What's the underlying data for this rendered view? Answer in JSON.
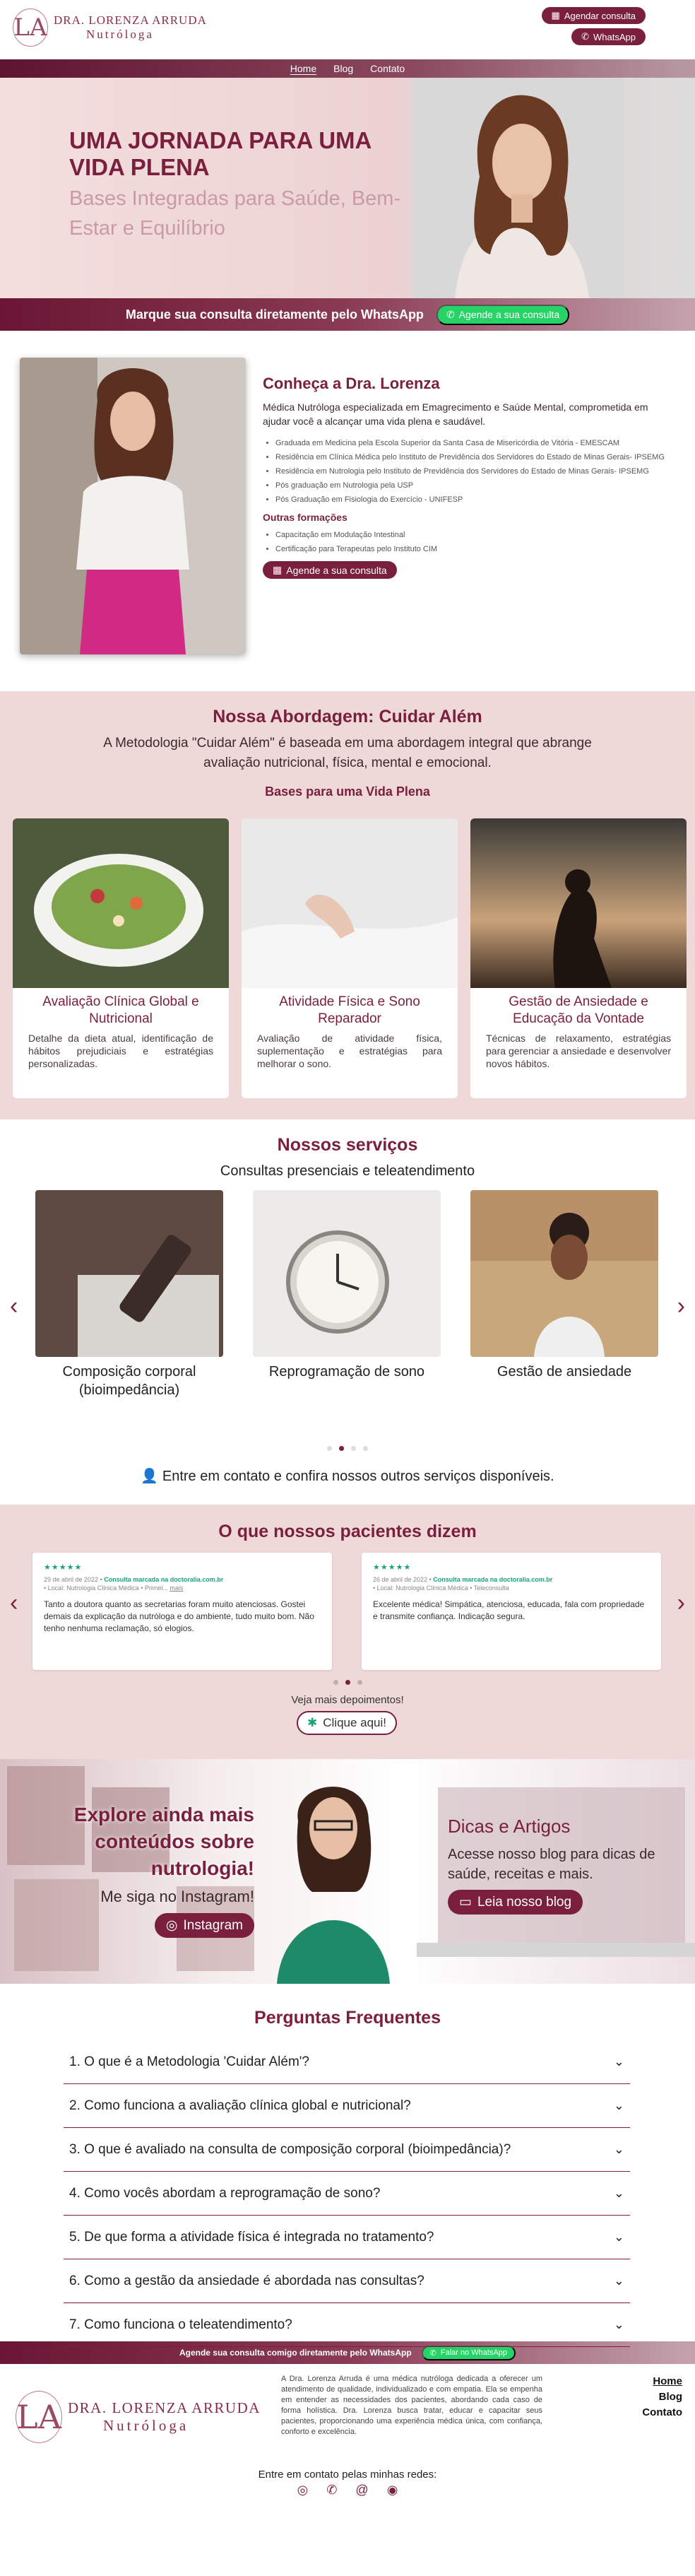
{
  "header": {
    "logo_line1": "DRA. LORENZA ARRUDA",
    "logo_line2": "Nutróloga",
    "logo_mark": "LA",
    "btn_schedule": "Agendar consulta",
    "btn_whatsapp": "WhatsApp"
  },
  "nav": {
    "items": [
      "Home",
      "Blog",
      "Contato"
    ],
    "active": "Home"
  },
  "hero": {
    "title": "UMA JORNADA PARA UMA VIDA PLENA",
    "subtitle": "Bases Integradas para Saúde, Bem-Estar e Equilíbrio"
  },
  "cta_bar": {
    "text": "Marque sua consulta diretamente pelo WhatsApp",
    "button": "Agende a sua consulta"
  },
  "about": {
    "title": "Conheça a Dra. Lorenza",
    "intro": "Médica Nutróloga especializada em Emagrecimento e Saúde Mental, comprometida em ajudar você a alcançar uma vida plena e saudável.",
    "education": [
      "Graduada em Medicina pela Escola Superior da Santa Casa de Misericórdia de Vitória - EMESCAM",
      "Residência em Clínica Médica pelo Instituto de Previdência dos Servidores do Estado de Minas Gerais- IPSEMG",
      "Residência em Nutrologia pelo Instituto de Previdência dos Servidores do Estado de Minas Gerais- IPSEMG",
      "Pós graduação em Nutrologia pela USP",
      "Pós Graduação em Fisiologia do Exercício - UNIFESP"
    ],
    "other_title": "Outras formações",
    "other": [
      "Capacitação em Modulação Intestinal",
      "Certificação para Terapeutas pelo Instituto CIM"
    ],
    "button": "Agende a sua consulta"
  },
  "approach": {
    "title": "Nossa Abordagem: Cuidar Além",
    "lead": "A Metodologia \"Cuidar Além\" é baseada em uma abordagem integral que abrange avaliação nutricional, física, mental e emocional.",
    "subtitle": "Bases para uma Vida Plena",
    "cards": [
      {
        "title": "Avaliação Clínica Global e Nutricional",
        "text": "Detalhe da dieta atual, identificação de hábitos prejudiciais e estratégias personalizadas."
      },
      {
        "title": "Atividade Física e Sono Reparador",
        "text": "Avaliação de atividade física, suplementação e estratégias para melhorar o sono."
      },
      {
        "title": "Gestão de Ansiedade e Educação da Vontade",
        "text": "Técnicas de relaxamento, estratégias para gerenciar a ansiedade e desenvolver novos hábitos."
      }
    ]
  },
  "services": {
    "title": "Nossos serviços",
    "subtitle": "Consultas presenciais e teleatendimento",
    "items": [
      {
        "caption": "Composição corporal (bioimpedância)"
      },
      {
        "caption": "Reprogramação de sono"
      },
      {
        "caption": "Gestão de ansiedade"
      }
    ],
    "dots": 4,
    "active_dot": 1,
    "contact": "Entre em contato e confira nossos outros serviços disponíveis."
  },
  "testimonials": {
    "title": "O que nossos pacientes dizem",
    "reviews": [
      {
        "stars": "★★★★★",
        "date": "29 de abril de 2022 •",
        "source": "Consulta marcada na doctoralia.com.br",
        "location": "• Local: Nutrologia Clínica Médica • Primei...",
        "more": "mais",
        "text": "Tanto a doutora quanto as secretarias foram muito atenciosas. Gostei demais da explicação da nutróloga e do ambiente, tudo muito bom. Não tenho nenhuma reclamação, só elogios."
      },
      {
        "stars": "★★★★★",
        "date": "26 de abril de 2022 •",
        "source": "Consulta marcada na doctoralia.com.br",
        "location": "• Local: Nutrologia Clínica Médica • Teleconsulta",
        "more": "",
        "text": "Excelente médica! Simpática, atenciosa, educada, fala com propriedade e transmite confiança. Indicação segura."
      }
    ],
    "dots": 3,
    "active_dot": 1,
    "more_text": "Veja mais depoimentos!",
    "button": "Clique aqui!"
  },
  "instagram": {
    "title": "Explore ainda mais conteúdos sobre nutrologia!",
    "text": "Me siga no Instagram!",
    "button": "Instagram"
  },
  "blog": {
    "title": "Dicas e Artigos",
    "text": "Acesse nosso blog para dicas de saúde, receitas e mais.",
    "button": "Leia nosso blog"
  },
  "faq": {
    "title": "Perguntas Frequentes",
    "items": [
      "1. O que é a Metodologia 'Cuidar Além'?",
      "2. Como funciona a avaliação clínica global e nutricional?",
      "3. O que é avaliado na consulta de composição corporal (bioimpedância)?",
      "4. Como vocês abordam a reprogramação de sono?",
      "5. De que forma a atividade física é integrada no tratamento?",
      "6. Como a gestão da ansiedade é abordada nas consultas?",
      "7. Como funciona o teleatendimento?"
    ]
  },
  "footer": {
    "bar_text": "Agende sua consulta comigo diretamente pelo WhatsApp",
    "bar_button": "Falar no WhatsApp",
    "about": "A Dra. Lorenza Arruda é uma médica nutróloga dedicada a oferecer um atendimento de qualidade, individualizado e com empatia. Ela se empenha em entender as necessidades dos pacientes, abordando cada caso de forma holística. Dra. Lorenza busca tratar, educar e capacitar seus pacientes, proporcionando uma experiência médica única, com confiança, conforto e excelência.",
    "nav": [
      "Home",
      "Blog",
      "Contato"
    ],
    "social_text": "Entre em contato pelas minhas redes:",
    "social_icons": [
      "instagram-icon",
      "phone-icon",
      "email-icon",
      "whatsapp-icon"
    ]
  },
  "colors": {
    "brand": "#7a1f3d",
    "accent_bg": "#efd8d8",
    "whatsapp": "#25d366",
    "stars": "#1aa37a"
  }
}
